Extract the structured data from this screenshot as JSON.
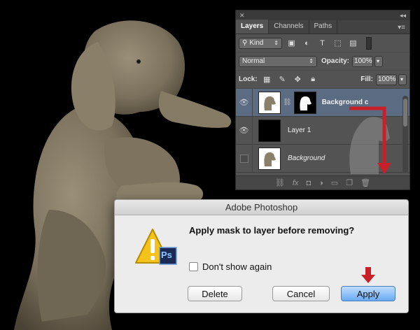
{
  "layers_panel": {
    "tabs": [
      {
        "label": "Layers",
        "active": true
      },
      {
        "label": "Channels",
        "active": false
      },
      {
        "label": "Paths",
        "active": false
      }
    ],
    "filter_kind": "Kind",
    "blend_mode": "Normal",
    "opacity_label": "Opacity:",
    "opacity_value": "100%",
    "lock_label": "Lock:",
    "fill_label": "Fill:",
    "fill_value": "100%",
    "layers": [
      {
        "name": "Background c",
        "selected": true,
        "visible": true,
        "thumb": "white",
        "has_mask": true
      },
      {
        "name": "Layer 1",
        "selected": false,
        "visible": true,
        "thumb": "black",
        "has_mask": false
      },
      {
        "name": "Background",
        "selected": false,
        "visible": false,
        "thumb": "white",
        "has_mask": false,
        "italic": true
      }
    ]
  },
  "dialog": {
    "title": "Adobe Photoshop",
    "message": "Apply mask to layer before removing?",
    "checkbox_label": "Don't show again",
    "checkbox_checked": false,
    "buttons": {
      "delete": "Delete",
      "cancel": "Cancel",
      "apply": "Apply"
    },
    "icon_badge": "Ps"
  },
  "colors": {
    "accent_red": "#c8202a",
    "selection_blue": "#5b6b82",
    "panel_bg": "#535353"
  }
}
